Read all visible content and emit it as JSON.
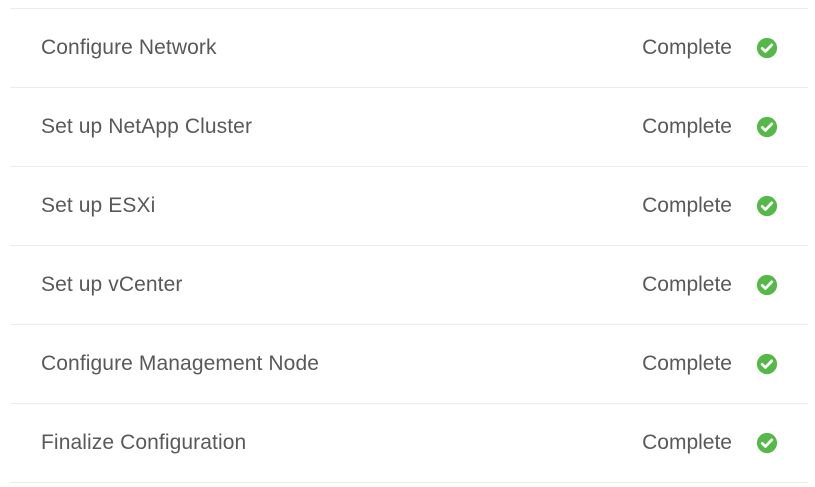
{
  "tasks": [
    {
      "label": "Configure Network",
      "status": "Complete",
      "icon": "check-circle-icon"
    },
    {
      "label": "Set up NetApp Cluster",
      "status": "Complete",
      "icon": "check-circle-icon"
    },
    {
      "label": "Set up ESXi",
      "status": "Complete",
      "icon": "check-circle-icon"
    },
    {
      "label": "Set up vCenter",
      "status": "Complete",
      "icon": "check-circle-icon"
    },
    {
      "label": "Configure Management Node",
      "status": "Complete",
      "icon": "check-circle-icon"
    },
    {
      "label": "Finalize Configuration",
      "status": "Complete",
      "icon": "check-circle-icon"
    }
  ],
  "colors": {
    "text": "#58595b",
    "success": "#55b948",
    "divider": "#ececec"
  }
}
